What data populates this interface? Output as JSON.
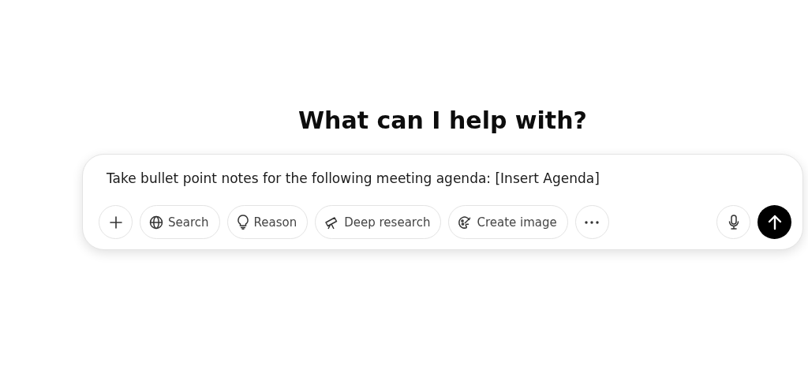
{
  "heading": "What can I help with?",
  "composer": {
    "value": "Take bullet point notes for the following meeting agenda: [Insert Agenda]",
    "tools": [
      {
        "kind": "plus"
      },
      {
        "kind": "globe",
        "label": "Search"
      },
      {
        "kind": "bulb",
        "label": "Reason"
      },
      {
        "kind": "telescope",
        "label": "Deep research"
      },
      {
        "kind": "palette",
        "label": "Create image"
      },
      {
        "kind": "more"
      }
    ]
  }
}
